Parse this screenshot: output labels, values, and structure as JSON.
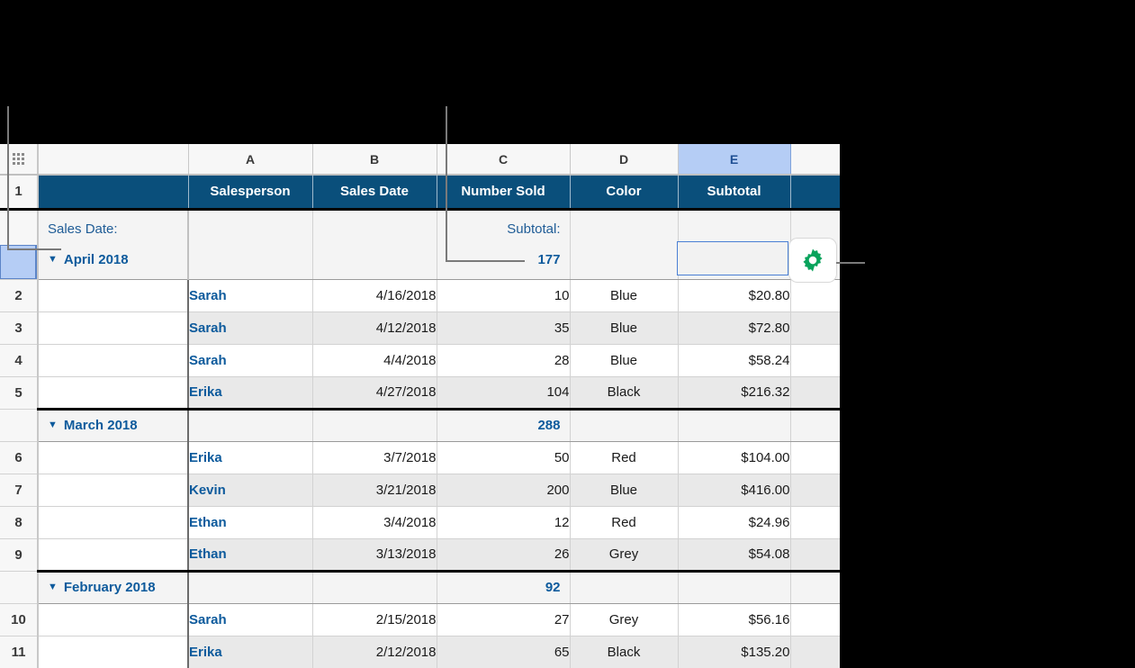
{
  "app": {
    "type": "spreadsheet-table",
    "accent_header_color": "#0a4f7b",
    "selection_color": "#b5cdf5",
    "gear_color": "#09a35c"
  },
  "column_headers": {
    "select_all_icon": "grid-dots-icon",
    "letters": [
      "",
      "A",
      "B",
      "C",
      "D",
      "E",
      ""
    ],
    "selected_letter": "E"
  },
  "table": {
    "header_row_number": "1",
    "headers": [
      "",
      "Salesperson",
      "Sales Date",
      "Number Sold",
      "Color",
      "Subtotal",
      ""
    ],
    "summary_top": {
      "category_label": "Sales Date:",
      "category_value": "April 2018",
      "subtotal_label": "Subtotal:",
      "subtotal_value": "177",
      "disclosure_icon": "triangle-down-icon",
      "selected_cell_value": ""
    },
    "groups": [
      {
        "name": "April 2018",
        "subtotal": "177",
        "is_top_summary": true,
        "rows": [
          {
            "num": "2",
            "salesperson": "Sarah",
            "date": "4/16/2018",
            "number_sold": "10",
            "color": "Blue",
            "subtotal": "$20.80"
          },
          {
            "num": "3",
            "salesperson": "Sarah",
            "date": "4/12/2018",
            "number_sold": "35",
            "color": "Blue",
            "subtotal": "$72.80"
          },
          {
            "num": "4",
            "salesperson": "Sarah",
            "date": "4/4/2018",
            "number_sold": "28",
            "color": "Blue",
            "subtotal": "$58.24"
          },
          {
            "num": "5",
            "salesperson": "Erika",
            "date": "4/27/2018",
            "number_sold": "104",
            "color": "Black",
            "subtotal": "$216.32"
          }
        ]
      },
      {
        "name": "March 2018",
        "subtotal": "288",
        "is_top_summary": false,
        "rows": [
          {
            "num": "6",
            "salesperson": "Erika",
            "date": "3/7/2018",
            "number_sold": "50",
            "color": "Red",
            "subtotal": "$104.00"
          },
          {
            "num": "7",
            "salesperson": "Kevin",
            "date": "3/21/2018",
            "number_sold": "200",
            "color": "Blue",
            "subtotal": "$416.00"
          },
          {
            "num": "8",
            "salesperson": "Ethan",
            "date": "3/4/2018",
            "number_sold": "12",
            "color": "Red",
            "subtotal": "$24.96"
          },
          {
            "num": "9",
            "salesperson": "Ethan",
            "date": "3/13/2018",
            "number_sold": "26",
            "color": "Grey",
            "subtotal": "$54.08"
          }
        ]
      },
      {
        "name": "February 2018",
        "subtotal": "92",
        "is_top_summary": false,
        "rows": [
          {
            "num": "10",
            "salesperson": "Sarah",
            "date": "2/15/2018",
            "number_sold": "27",
            "color": "Grey",
            "subtotal": "$56.16"
          },
          {
            "num": "11",
            "salesperson": "Erika",
            "date": "2/12/2018",
            "number_sold": "65",
            "color": "Black",
            "subtotal": "$135.20"
          }
        ]
      }
    ]
  },
  "callouts": {
    "gear_icon": "gear-icon"
  }
}
